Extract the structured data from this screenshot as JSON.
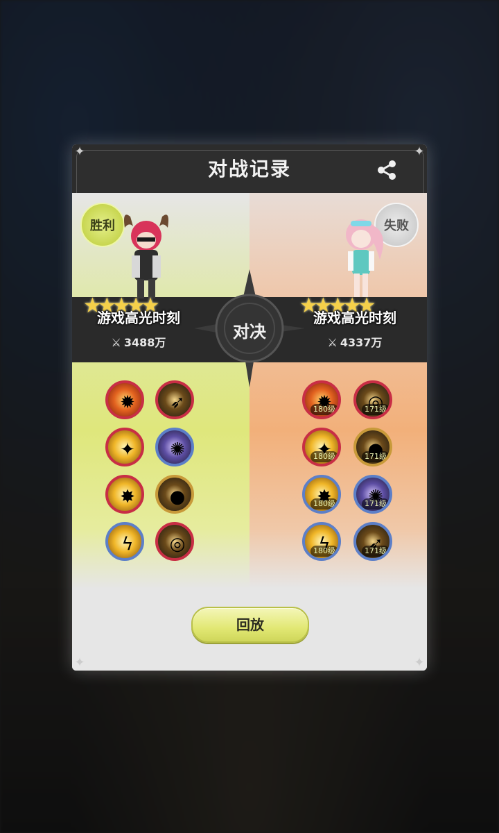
{
  "dialog": {
    "title": "对战记录",
    "vs_label": "对决",
    "replay_label": "回放"
  },
  "left_player": {
    "result": "胜利",
    "title": "游戏高光时刻",
    "power": "3488万",
    "stars": 5,
    "skills": [
      {
        "icon": "fire-burst-icon",
        "level": ""
      },
      {
        "icon": "spear-icon",
        "level": ""
      },
      {
        "icon": "golden-wings-icon",
        "level": ""
      },
      {
        "icon": "purple-orb-icon",
        "level": ""
      },
      {
        "icon": "explosion-icon",
        "level": ""
      },
      {
        "icon": "shadow-figure-icon",
        "level": ""
      },
      {
        "icon": "lightning-spirit-icon",
        "level": ""
      },
      {
        "icon": "golden-shield-icon",
        "level": ""
      }
    ]
  },
  "right_player": {
    "result": "失败",
    "title": "游戏高光时刻",
    "power": "4337万",
    "stars": 5,
    "skills": [
      {
        "icon": "fire-burst-icon",
        "level": "180级"
      },
      {
        "icon": "golden-shield-icon",
        "level": "171级"
      },
      {
        "icon": "golden-wings-icon",
        "level": "180级"
      },
      {
        "icon": "shadow-figure-icon",
        "level": "171级"
      },
      {
        "icon": "explosion-icon",
        "level": "180级"
      },
      {
        "icon": "purple-orb-icon",
        "level": "171级"
      },
      {
        "icon": "lightning-spirit-icon",
        "level": "180级"
      },
      {
        "icon": "spear-icon",
        "level": "171级"
      }
    ]
  }
}
